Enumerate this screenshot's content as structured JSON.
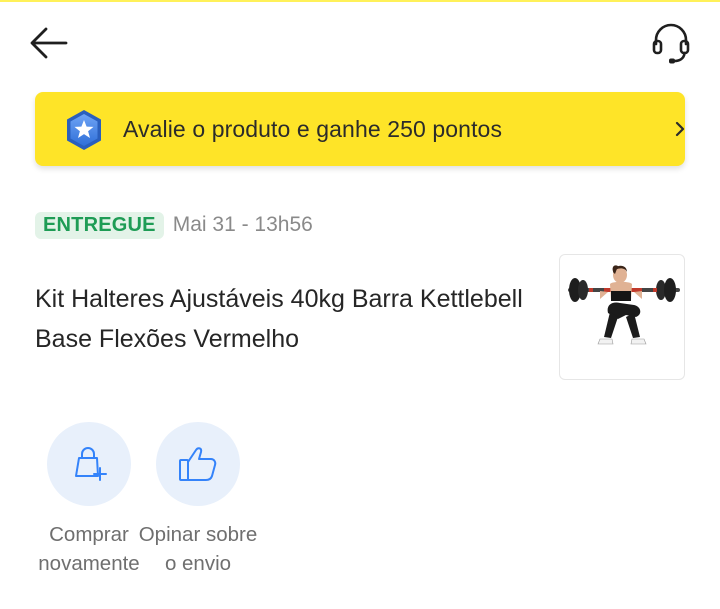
{
  "header": {
    "back_icon": "arrow-left-icon",
    "help_icon": "headset-icon"
  },
  "banner": {
    "icon": "star-shield-icon",
    "text": "Avalie o produto e ganhe 250 pontos",
    "chevron_icon": "chevron-right-icon",
    "background_color": "#fee428"
  },
  "order": {
    "status": "ENTREGUE",
    "status_color": "#1e9c55",
    "date": "Mai 31 - 13h56"
  },
  "product": {
    "title": "Kit Halteres Ajustáveis 40kg Barra Kettlebell Base Flexões Vermelho",
    "image": "woman-squatting-with-barbell"
  },
  "actions": [
    {
      "label": "Comprar novamente",
      "icon": "shopping-bag-plus-icon"
    },
    {
      "label": "Opinar sobre o envio",
      "icon": "thumbs-up-icon"
    }
  ],
  "colors": {
    "accent_blue": "#3483fa",
    "action_circle_bg": "#e8f0fb"
  }
}
